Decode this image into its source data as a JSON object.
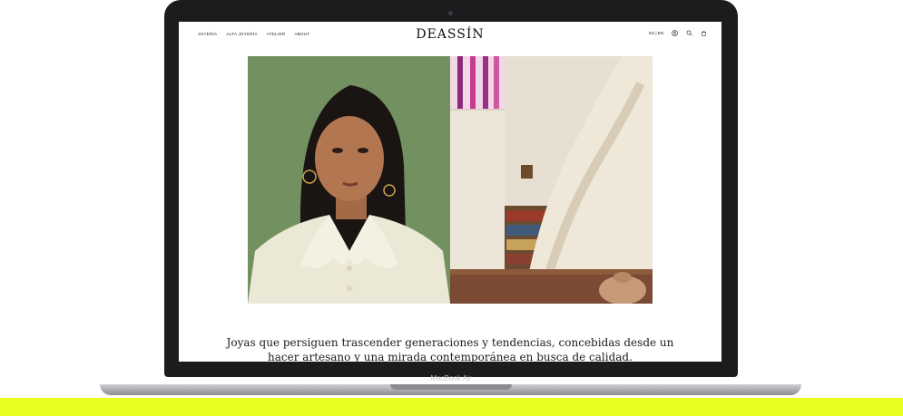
{
  "device": {
    "label": "MacBook Air"
  },
  "site": {
    "brand": "DEASSÍN",
    "nav": [
      "JOYERÍA",
      "ALTA JOYERÍA",
      "ATELIER",
      "ABOUT"
    ],
    "lang": "ES | EN",
    "icons": [
      "user-icon",
      "search-icon",
      "bag-icon"
    ]
  },
  "hero": {
    "left_image": "portrait-woman-green-background",
    "right_image": "spiral-staircase-interior"
  },
  "tagline": "Joyas que persiguen trascender generaciones y tendencias, concebidas desde un hacer artesano y una mirada contemporánea en busca de calidad.",
  "colors": {
    "accent_band": "#e9ff1f",
    "laptop": "#1b1c1e"
  }
}
